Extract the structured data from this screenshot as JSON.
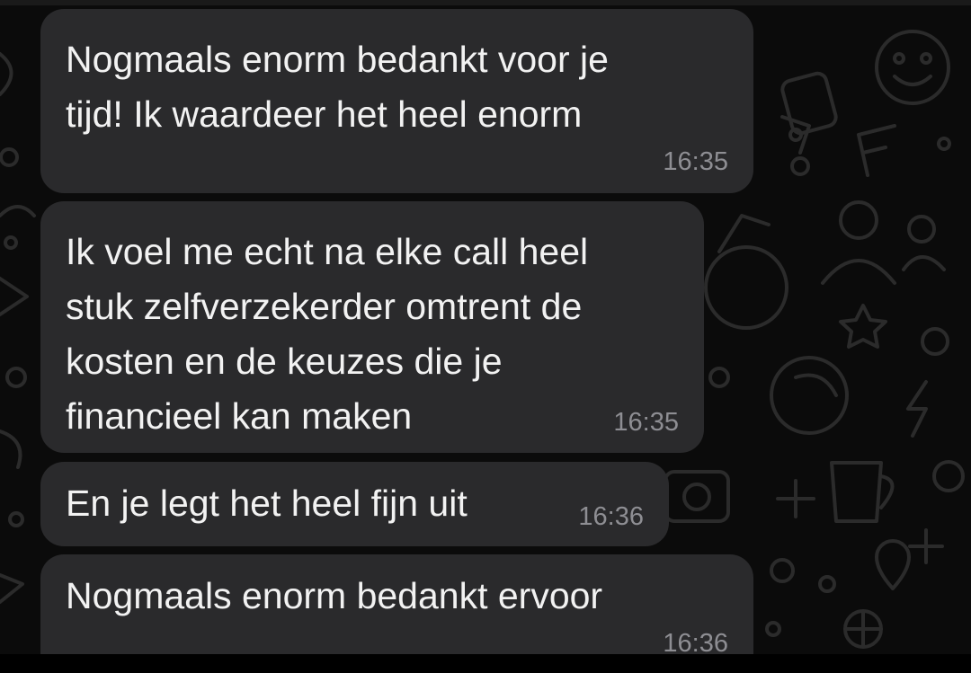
{
  "messages": [
    {
      "text": "Nogmaals enorm bedankt voor je\ntijd! Ik waardeer het heel enorm",
      "time": "16:35"
    },
    {
      "text": "Ik voel me echt na elke call heel\nstuk zelfverzekerder omtrent de\nkosten en de keuzes die je\nfinancieel kan maken",
      "time": "16:35"
    },
    {
      "text": "En je legt het heel fijn uit",
      "time": "16:36"
    },
    {
      "text": "Nogmaals enorm bedankt ervoor",
      "time": "16:36"
    }
  ],
  "colors": {
    "background": "#0b0b0b",
    "bubble": "#2a2a2c",
    "text": "#f2f2f2",
    "timestamp": "#8e8e93",
    "wallpaper_doodle": "#2b2b2b"
  }
}
